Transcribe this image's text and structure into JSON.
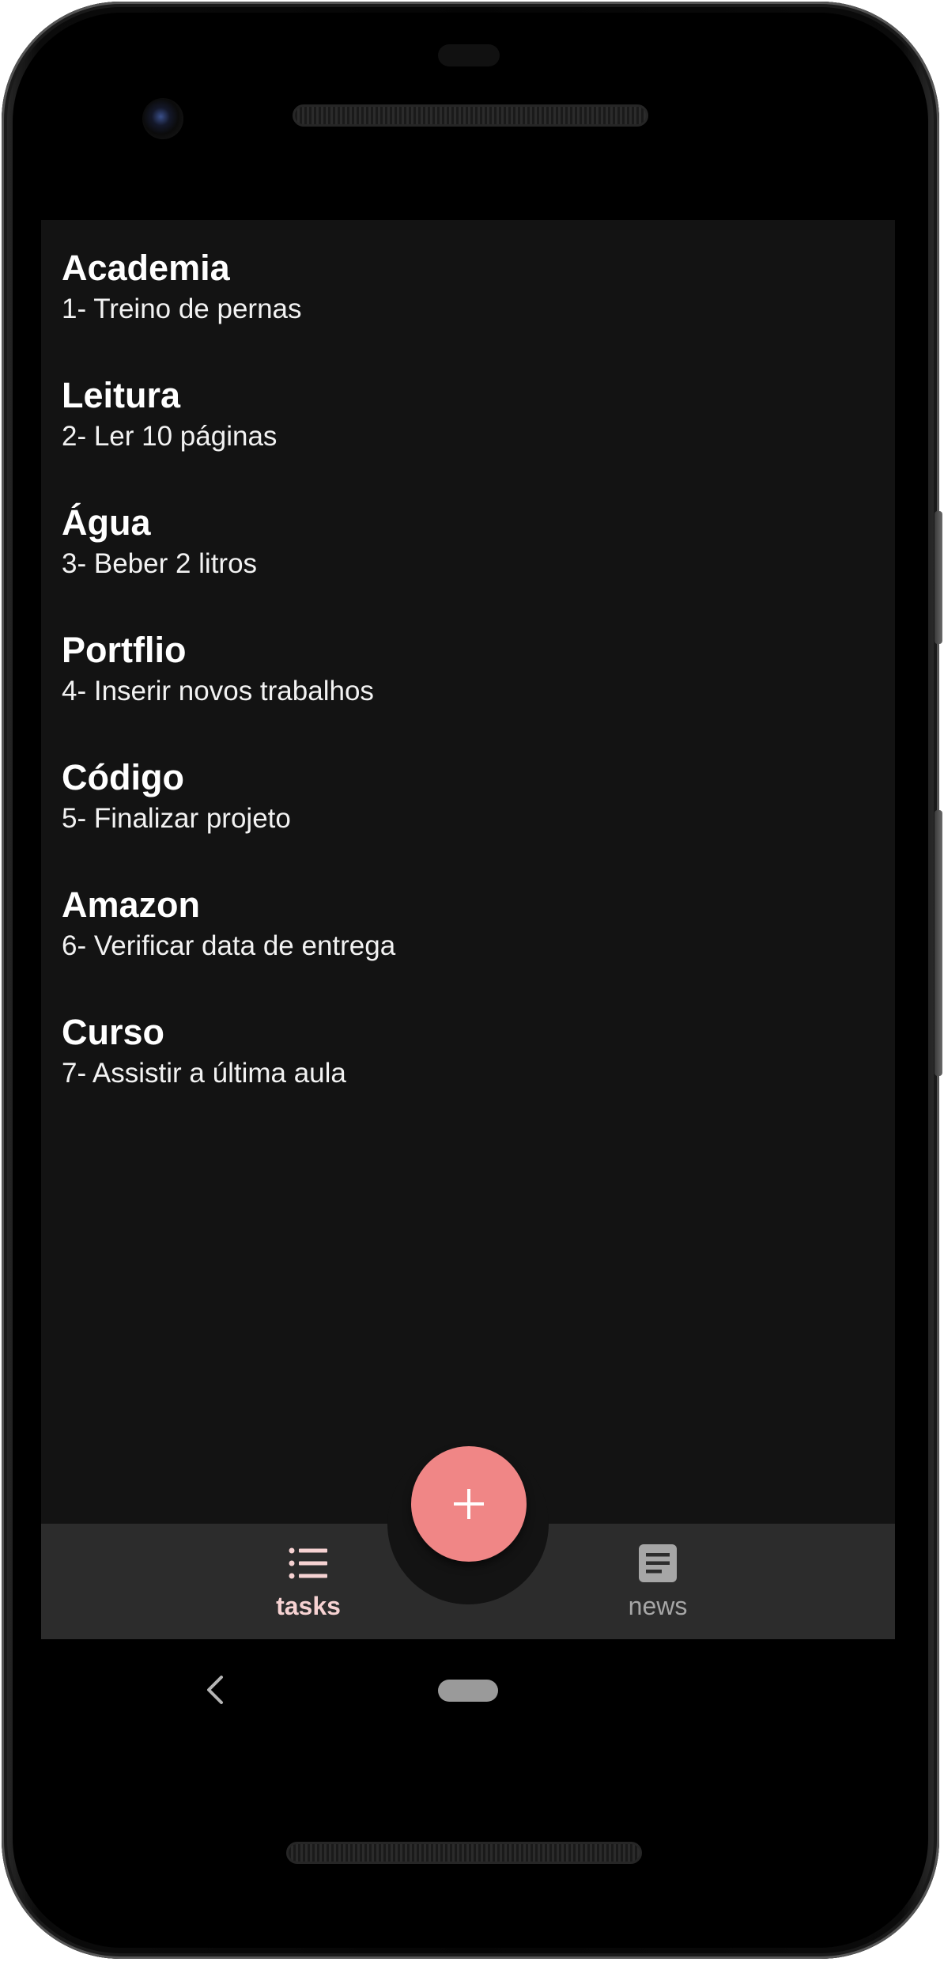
{
  "tasks": [
    {
      "title": "Academia",
      "description": "1- Treino de pernas"
    },
    {
      "title": "Leitura",
      "description": "2- Ler 10 páginas"
    },
    {
      "title": "Água",
      "description": "3- Beber 2 litros"
    },
    {
      "title": "Portflio",
      "description": "4- Inserir novos trabalhos"
    },
    {
      "title": "Código",
      "description": "5- Finalizar projeto"
    },
    {
      "title": "Amazon",
      "description": "6- Verificar data de entrega"
    },
    {
      "title": "Curso",
      "description": "7- Assistir a última aula"
    }
  ],
  "fab": {
    "icon": "plus-icon"
  },
  "bottom_nav": {
    "tasks": {
      "label": "tasks",
      "icon": "list-icon",
      "active": true
    },
    "news": {
      "label": "news",
      "icon": "article-icon",
      "active": false
    }
  },
  "system_nav": {
    "back_icon": "back-chevron-icon",
    "home_icon": "home-pill-icon"
  },
  "colors": {
    "background": "#131313",
    "bottom_bar": "#2c2c2c",
    "fab": "#f08686",
    "active_nav": "#f6d2d2",
    "inactive_nav": "#a6a6a6"
  }
}
